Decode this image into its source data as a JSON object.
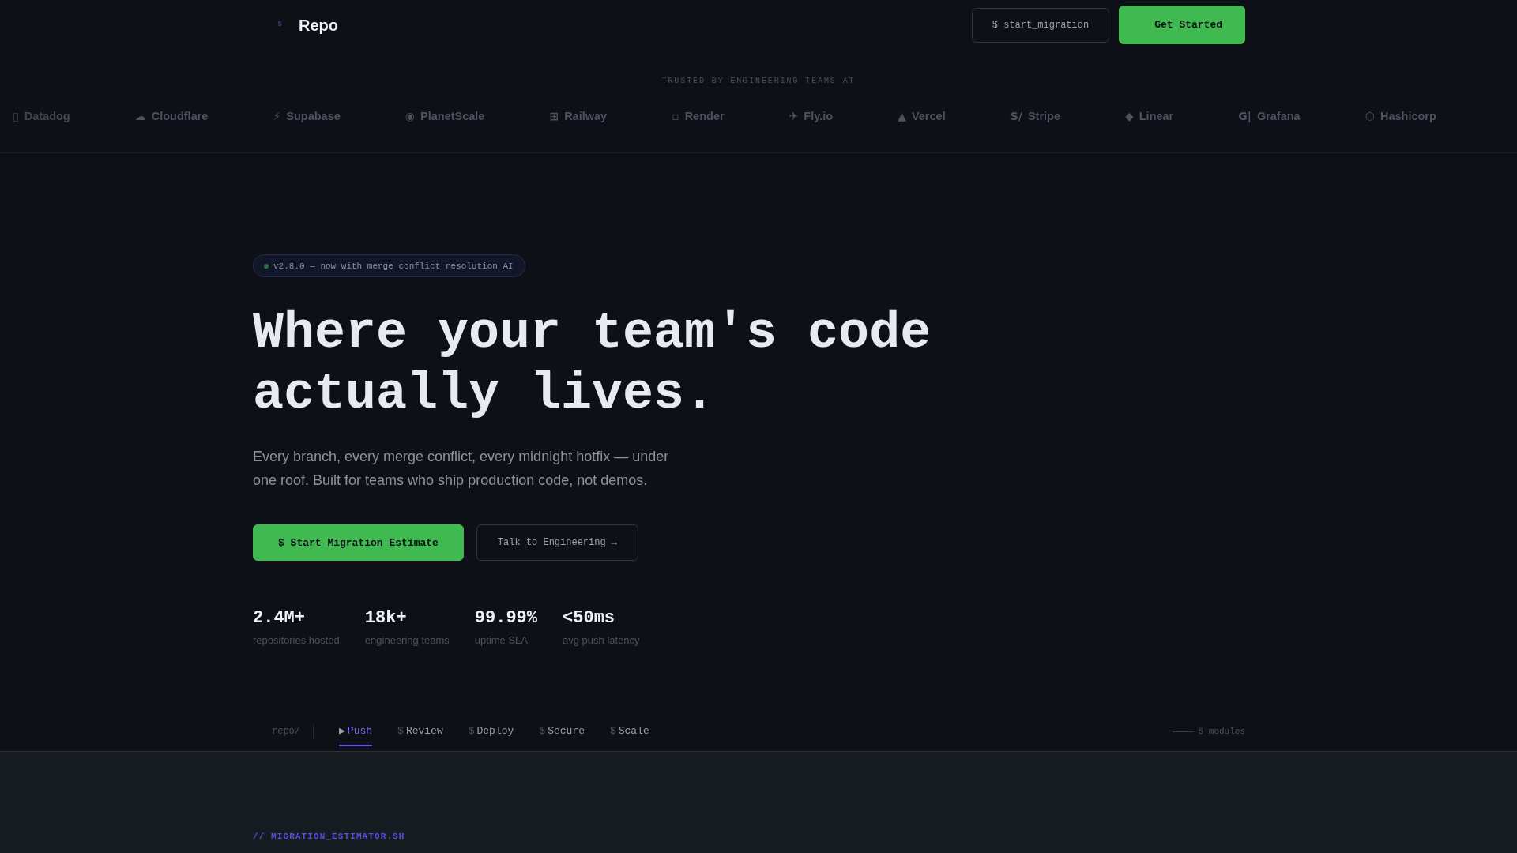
{
  "header": {
    "logo_mark": "$",
    "brand": "Repo",
    "buttons": [
      {
        "label": "$ start_migration",
        "kind": "outline"
      },
      {
        "label": "Get Started",
        "kind": "primary"
      }
    ]
  },
  "trust_strip": {
    "caption": "TRUSTED BY ENGINEERING TEAMS AT",
    "logos": [
      {
        "glyph": "▯",
        "name": "Datadog"
      },
      {
        "glyph": "☁",
        "name": "Cloudflare"
      },
      {
        "glyph": "⚡",
        "name": "Supabase"
      },
      {
        "glyph": "◉",
        "name": "PlanetScale"
      },
      {
        "glyph": "⊞",
        "name": "Railway"
      },
      {
        "glyph": "▫",
        "name": "Render"
      },
      {
        "glyph": "✈",
        "name": "Fly.io"
      },
      {
        "glyph": "▲",
        "name": "Vercel"
      },
      {
        "glyph": "S/",
        "name": "Stripe"
      },
      {
        "glyph": "◆",
        "name": "Linear"
      },
      {
        "glyph": "G|",
        "name": "Grafana"
      },
      {
        "glyph": "⬡",
        "name": "Hashicorp"
      }
    ]
  },
  "hero": {
    "badge": "v2.8.0 — now with merge conflict resolution AI",
    "title": "Where your team's code actually lives.",
    "subtitle": "Every branch, every merge conflict, every midnight hotfix — under one roof. Built for teams who ship production code, not demos.",
    "buttons": [
      {
        "label": "$ Start Migration Estimate",
        "kind": "primary"
      },
      {
        "label": "Talk to Engineering →",
        "kind": "outline"
      }
    ],
    "stats": [
      {
        "value": "2.4M+",
        "label": "repositories hosted"
      },
      {
        "value": "18k+",
        "label": "engineering teams"
      },
      {
        "value": "99.99%",
        "label": "uptime SLA"
      },
      {
        "value": "<50ms",
        "label": "avg push latency"
      }
    ]
  },
  "module_tabs": {
    "path": "repo/",
    "tabs": [
      {
        "glyph": "▶",
        "label": "Push",
        "selected": true
      },
      {
        "glyph": "$",
        "label": "Review",
        "selected": false
      },
      {
        "glyph": "$",
        "label": "Deploy",
        "selected": false
      },
      {
        "glyph": "$",
        "label": "Secure",
        "selected": false
      },
      {
        "glyph": "$",
        "label": "Scale",
        "selected": false
      }
    ],
    "count": "5 modules"
  },
  "section": {
    "eyebrow": "// MIGRATION_ESTIMATOR.SH"
  }
}
